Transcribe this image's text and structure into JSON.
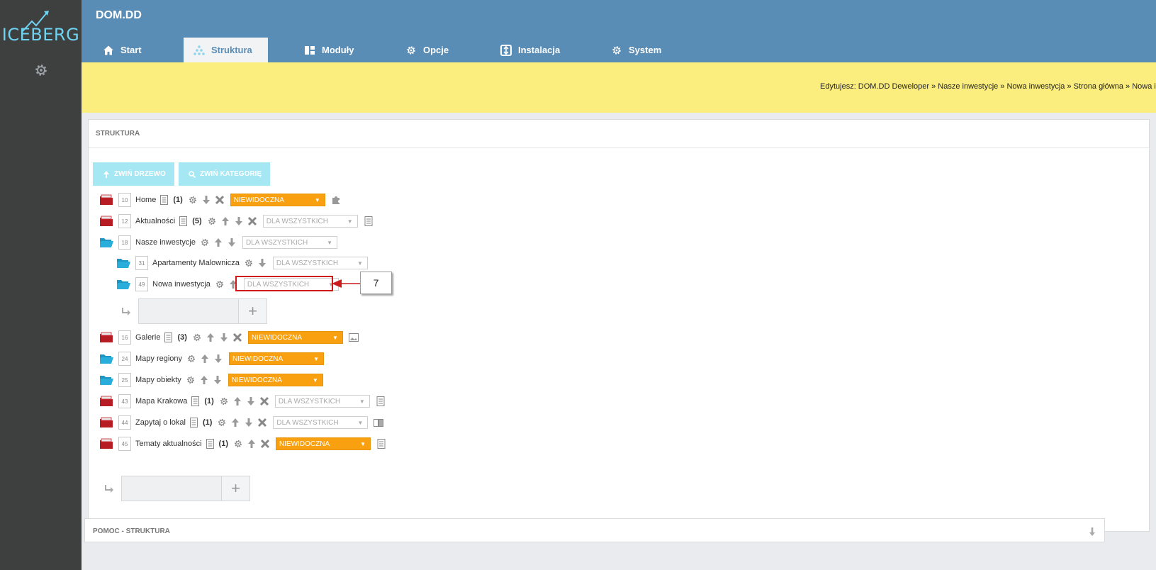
{
  "brand": {
    "name": "ICEBERG"
  },
  "header": {
    "title": "DOM.DD"
  },
  "tabs": [
    {
      "label": "Start",
      "icon": "home-icon"
    },
    {
      "label": "Struktura",
      "icon": "sitemap-icon",
      "active": true
    },
    {
      "label": "Moduły",
      "icon": "modules-icon"
    },
    {
      "label": "Opcje",
      "icon": "gear-icon"
    },
    {
      "label": "Instalacja",
      "icon": "install-icon"
    },
    {
      "label": "System",
      "icon": "gear-icon"
    }
  ],
  "breadcrumb": "Edytujesz: DOM.DD Deweloper » Nasze inwestycje » Nowa inwestycja » Strona główna » Nowa inw",
  "panel": {
    "title": "STRUKTURA",
    "collapse_tree": "ZWIŃ DRZEWO",
    "collapse_category": "ZWIŃ KATEGORIĘ"
  },
  "tree": [
    {
      "id": "10",
      "name": "Home",
      "count": "(1)",
      "visibility": "NIEWIDOCZNA",
      "folder": "red"
    },
    {
      "id": "12",
      "name": "Aktualności",
      "count": "(5)",
      "visibility": "DLA WSZYSTKICH",
      "folder": "red"
    },
    {
      "id": "18",
      "name": "Nasze inwestycje",
      "visibility": "DLA WSZYSTKICH",
      "folder": "blue"
    },
    {
      "id": "31",
      "name": "Apartamenty Malownicza",
      "visibility": "DLA WSZYSTKICH",
      "folder": "blue"
    },
    {
      "id": "49",
      "name": "Nowa inwestycja",
      "visibility": "DLA WSZYSTKICH",
      "folder": "blue"
    },
    {
      "id": "16",
      "name": "Galerie",
      "count": "(3)",
      "visibility": "NIEWIDOCZNA",
      "folder": "red"
    },
    {
      "id": "24",
      "name": "Mapy regiony",
      "visibility": "NIEWIDOCZNA",
      "folder": "blue"
    },
    {
      "id": "25",
      "name": "Mapy obiekty",
      "visibility": "NIEWIDOCZNA",
      "folder": "blue"
    },
    {
      "id": "43",
      "name": "Mapa Krakowa",
      "count": "(1)",
      "visibility": "DLA WSZYSTKICH",
      "folder": "red"
    },
    {
      "id": "44",
      "name": "Zapytaj o lokal",
      "count": "(1)",
      "visibility": "DLA WSZYSTKICH",
      "folder": "red"
    },
    {
      "id": "45",
      "name": "Tematy aktualności",
      "count": "(1)",
      "visibility": "NIEWIDOCZNA",
      "folder": "red"
    }
  ],
  "annotation": {
    "label": "7"
  },
  "help": {
    "title": "POMOC - STRUKTURA"
  },
  "colors": {
    "header": "#5a8db6",
    "sidebar": "#3e3f3f",
    "breadcrumb_bar": "#fbee7e",
    "orange_select": "#f9a010",
    "folder_red": "#c4232b",
    "folder_blue": "#29aedc",
    "annotation_red": "#cc1a1a"
  }
}
